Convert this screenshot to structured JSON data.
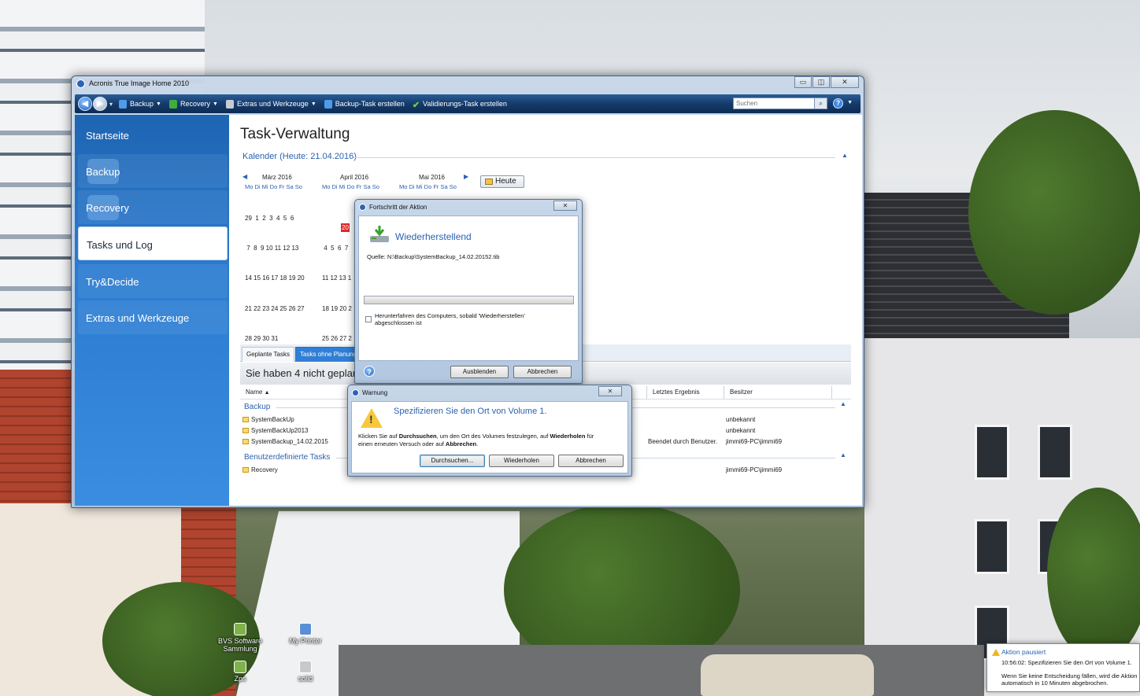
{
  "desktop": {
    "icons": [
      {
        "label": "BVS Software Sammlung"
      },
      {
        "label": "My Printer"
      },
      {
        "label": "Zps"
      },
      {
        "label": "solid"
      }
    ]
  },
  "window": {
    "title": "Acronis True Image Home 2010",
    "buttons": {
      "minimize": "▭",
      "maximize": "◫",
      "close": "✕"
    }
  },
  "toolbar": {
    "items": [
      {
        "label": "Backup",
        "icon": "backup-icon",
        "dropdown": true
      },
      {
        "label": "Recovery",
        "icon": "recovery-icon",
        "dropdown": true
      },
      {
        "label": "Extras und Werkzeuge",
        "icon": "tools-icon",
        "dropdown": true
      },
      {
        "label": "Backup-Task erstellen",
        "icon": "backup-task-icon",
        "dropdown": false
      },
      {
        "label": "Validierungs-Task erstellen",
        "icon": "check-icon",
        "dropdown": false
      }
    ],
    "search_placeholder": "Suchen",
    "help": "?"
  },
  "sidebar": {
    "items": [
      {
        "label": "Startseite"
      },
      {
        "label": "Backup"
      },
      {
        "label": "Recovery"
      },
      {
        "label": "Tasks und Log",
        "selected": true
      },
      {
        "label": "Try&Decide"
      },
      {
        "label": "Extras und Werkzeuge"
      }
    ]
  },
  "main": {
    "title": "Task-Verwaltung",
    "calendar": {
      "heading": "Kalender (Heute: 21.04.2016)",
      "today_button": "Heute",
      "weekday_header": "Mo Di Mi Do Fr Sa So",
      "months": [
        {
          "name": "März 2016",
          "weeks": [
            "29  1  2  3  4  5  6",
            " 7  8  9 10 11 12 13",
            "14 15 16 17 18 19 20",
            "21 22 23 24 25 26 27",
            "28 29 30 31"
          ]
        },
        {
          "name": "April 2016",
          "weeks": [
            " ",
            " 4  5  6  7",
            "11 12 13 1",
            "18 19 20 2",
            "25 26 27 2"
          ]
        },
        {
          "name": "Mai 2016",
          "weeks": []
        }
      ],
      "today_day": "20"
    },
    "tabs": [
      {
        "label": "Geplante Tasks",
        "active": false
      },
      {
        "label": "Tasks ohne Planung",
        "active": true
      }
    ],
    "info_text": "Sie haben 4 nicht geplante",
    "columns": {
      "name": "Name",
      "last_result": "Letztes Ergebnis",
      "owner": "Besitzer"
    },
    "groups": [
      {
        "label": "Backup",
        "rows": [
          {
            "name": "SystemBackUp",
            "result": "",
            "owner": "unbekannt"
          },
          {
            "name": "SystemBackUp2013",
            "result": "",
            "owner": "unbekannt"
          },
          {
            "name": "SystemBackup_14.02.2015",
            "result": "Beendet durch Benutzer.",
            "owner": "jimmi69-PC\\jimmi69"
          }
        ]
      },
      {
        "label": "Benutzerdefinierte Tasks",
        "rows": [
          {
            "name": "Recovery",
            "result": "",
            "owner": "jimmi69-PC\\jimmi69"
          }
        ]
      }
    ]
  },
  "progress_dialog": {
    "title": "Fortschritt der Aktion",
    "heading": "Wiederherstellend",
    "source": "Quelle: N:\\Backup\\SystemBackup_14.02.20152.tib",
    "progress": 0.0,
    "checkbox_label_1": "Herunterfahren des Computers, sobald 'Wiederherstellen'",
    "checkbox_label_2": "abgeschlossen ist",
    "checkbox_checked": false,
    "hide_button": "Ausblenden",
    "cancel_button": "Abbrechen"
  },
  "warning_dialog": {
    "title": "Warnung",
    "heading": "Spezifizieren Sie den Ort von Volume 1.",
    "message_line1_pre": "Klicken Sie auf ",
    "message_bold1": "Durchsuchen",
    "message_line1_mid": ", um den Ort des Volumes festzulegen, auf ",
    "message_bold2": "Wiederholen",
    "message_line1_post": " für",
    "message_line2_pre": "einen erneuten Versuch oder auf ",
    "message_bold3": "Abbrechen",
    "message_line2_post": ".",
    "browse_button": "Durchsuchen...",
    "retry_button": "Wiederholen",
    "cancel_button": "Abbrechen"
  },
  "notification": {
    "title": "Aktion pausiert",
    "line1": "10:56:02: Spezifizieren Sie den Ort von Volume 1.",
    "line2": "Wenn Sie keine Entscheidung fällen, wird die Aktion",
    "line3": "automatisch in 10 Minuten abgebrochen."
  },
  "colors": {
    "accent": "#2b62b1",
    "toolbar": "#143b6b",
    "sidebar": "#2b7bd0",
    "weekend": "#d23b2b",
    "today": "#e0282a"
  }
}
